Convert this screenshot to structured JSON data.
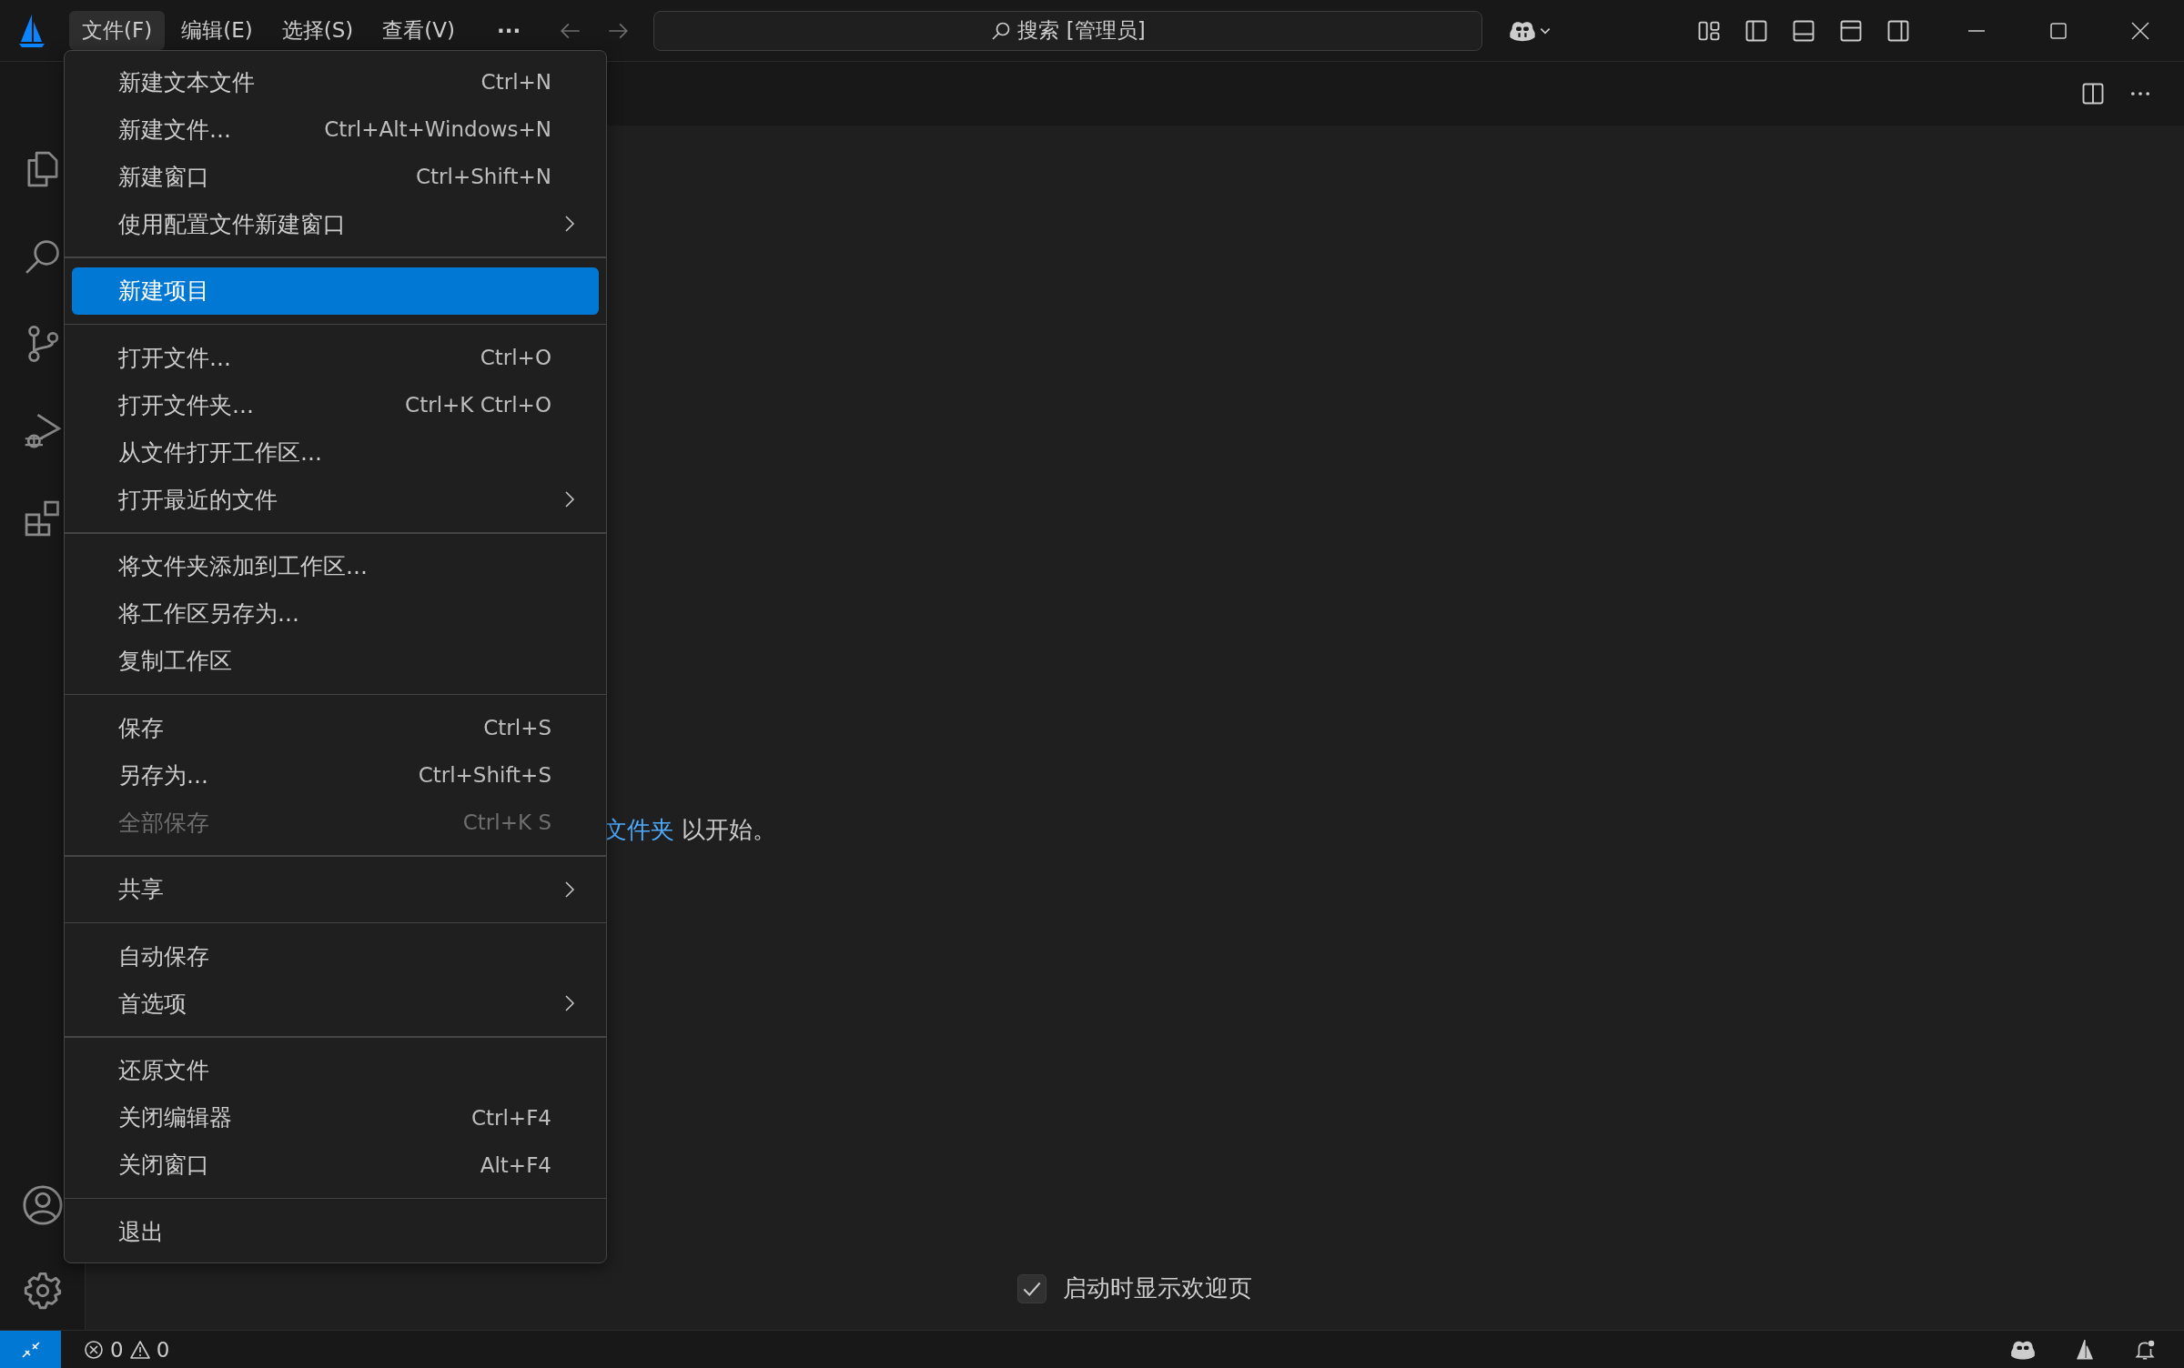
{
  "title_bar": {
    "menus": [
      {
        "label": "文件(F)",
        "selected": true
      },
      {
        "label": "编辑(E)",
        "selected": false
      },
      {
        "label": "选择(S)",
        "selected": false
      },
      {
        "label": "查看(V)",
        "selected": false
      }
    ],
    "more": "···",
    "command_center": {
      "label": "搜索 [管理员]"
    }
  },
  "file_menu": {
    "groups": [
      {
        "items": [
          {
            "label": "新建文本文件",
            "shortcut": "Ctrl+N",
            "submenu": false,
            "disabled": false,
            "selected": false
          },
          {
            "label": "新建文件...",
            "shortcut": "Ctrl+Alt+Windows+N",
            "submenu": false,
            "disabled": false,
            "selected": false
          },
          {
            "label": "新建窗口",
            "shortcut": "Ctrl+Shift+N",
            "submenu": false,
            "disabled": false,
            "selected": false
          },
          {
            "label": "使用配置文件新建窗口",
            "submenu": true,
            "disabled": false,
            "selected": false
          }
        ]
      },
      {
        "items": [
          {
            "label": "新建项目",
            "submenu": false,
            "disabled": false,
            "selected": true
          }
        ]
      },
      {
        "items": [
          {
            "label": "打开文件...",
            "shortcut": "Ctrl+O",
            "submenu": false,
            "disabled": false,
            "selected": false
          },
          {
            "label": "打开文件夹...",
            "shortcut": "Ctrl+K Ctrl+O",
            "submenu": false,
            "disabled": false,
            "selected": false
          },
          {
            "label": "从文件打开工作区...",
            "submenu": false,
            "disabled": false,
            "selected": false
          },
          {
            "label": "打开最近的文件",
            "submenu": true,
            "disabled": false,
            "selected": false
          }
        ]
      },
      {
        "items": [
          {
            "label": "将文件夹添加到工作区...",
            "submenu": false,
            "disabled": false,
            "selected": false
          },
          {
            "label": "将工作区另存为...",
            "submenu": false,
            "disabled": false,
            "selected": false
          },
          {
            "label": "复制工作区",
            "submenu": false,
            "disabled": false,
            "selected": false
          }
        ]
      },
      {
        "items": [
          {
            "label": "保存",
            "shortcut": "Ctrl+S",
            "submenu": false,
            "disabled": false,
            "selected": false
          },
          {
            "label": "另存为...",
            "shortcut": "Ctrl+Shift+S",
            "submenu": false,
            "disabled": false,
            "selected": false
          },
          {
            "label": "全部保存",
            "shortcut": "Ctrl+K S",
            "submenu": false,
            "disabled": true,
            "selected": false
          }
        ]
      },
      {
        "items": [
          {
            "label": "共享",
            "submenu": true,
            "disabled": false,
            "selected": false
          }
        ]
      },
      {
        "items": [
          {
            "label": "自动保存",
            "submenu": false,
            "disabled": false,
            "selected": false
          },
          {
            "label": "首选项",
            "submenu": true,
            "disabled": false,
            "selected": false
          }
        ]
      },
      {
        "items": [
          {
            "label": "还原文件",
            "submenu": false,
            "disabled": false,
            "selected": false
          },
          {
            "label": "关闭编辑器",
            "shortcut": "Ctrl+F4",
            "submenu": false,
            "disabled": false,
            "selected": false
          },
          {
            "label": "关闭窗口",
            "shortcut": "Alt+F4",
            "submenu": false,
            "disabled": false,
            "selected": false
          }
        ]
      },
      {
        "items": [
          {
            "label": "退出",
            "submenu": false,
            "disabled": false,
            "selected": false
          }
        ]
      }
    ]
  },
  "editor": {
    "welcome": {
      "link": "文件夹",
      "text": "以开始。"
    },
    "show_on_startup": {
      "label": "启动时显示欢迎页",
      "checked": true
    }
  },
  "status_bar": {
    "errors": "0",
    "warnings": "0"
  }
}
